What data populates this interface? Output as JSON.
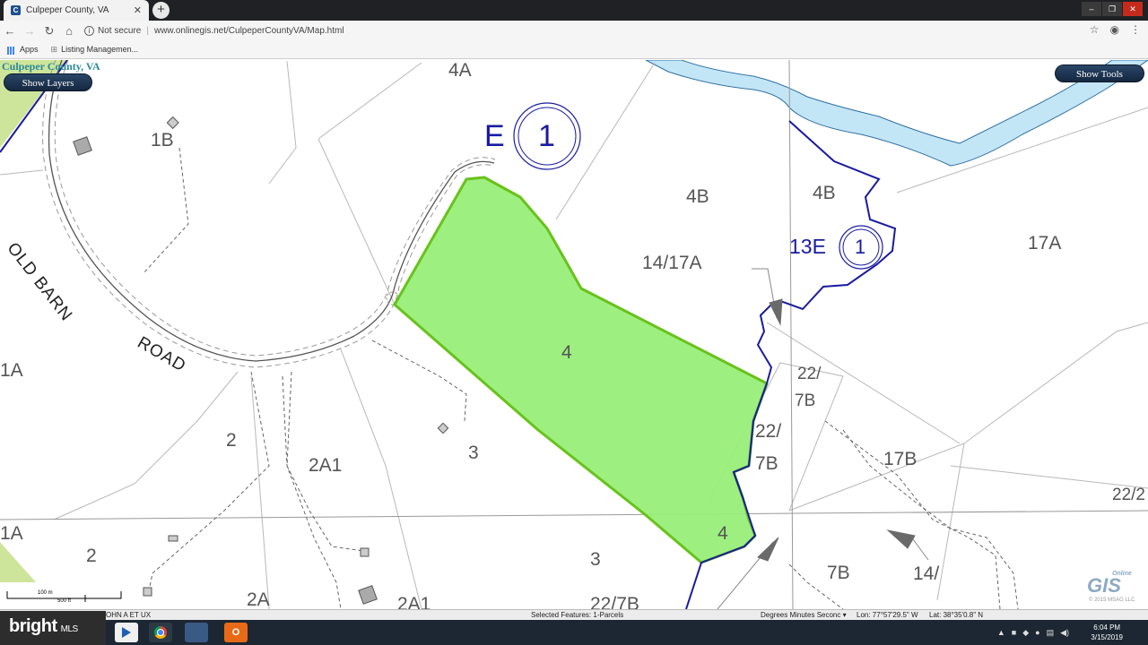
{
  "browser": {
    "tab_title": "Culpeper County, VA",
    "new_tab": "+",
    "security_label": "Not secure",
    "url": "www.onlinegis.net/CulpeperCountyVA/Map.html",
    "bookmarks": [
      "Apps",
      "Listing Managemen..."
    ]
  },
  "map": {
    "site_title": "Culpeper County, VA",
    "show_layers": "Show Layers",
    "show_tools": "Show Tools",
    "road_label_1": "OLD BARN",
    "road_label_2": "ROAD",
    "parcel_labels": [
      "4A",
      "1B",
      "4B",
      "4B",
      "14/17A",
      "17A",
      "1A",
      "2",
      "2A1",
      "3",
      "4",
      "22/",
      "7B",
      "22/",
      "7B",
      "17B",
      "22/2",
      "1A",
      "2",
      "3",
      "4",
      "7B",
      "14/",
      "2A",
      "2A1",
      "22/7B"
    ],
    "highlighted_parcel_labels": [
      "4",
      "4"
    ],
    "zone_labels": [
      {
        "letter": "E",
        "number": "1"
      },
      {
        "letter": "13E",
        "number": "1"
      }
    ],
    "scale_labels": [
      "100 m",
      "500 ft"
    ],
    "colors": {
      "selected_parcel": "#98ee78",
      "selected_outline": "#68c21b",
      "water": "#c3e6f7",
      "water_edge": "#2f6ea1",
      "zone": "#1a1aa0"
    }
  },
  "status_bar": {
    "owner": "OHN A ET UX",
    "selected": "Selected Features: 1-Parcels",
    "coord_mode": "Degrees Minutes Seconc ▾",
    "lon": "Lon: 77°57'29.5\" W",
    "lat": "Lat: 38°35'0.8\" N"
  },
  "branding": {
    "gis_logo": "GIS",
    "gis_online": "Online",
    "copyright": "© 2015 MSAG LLC"
  },
  "watermark": {
    "brand": "bright",
    "suffix": "MLS"
  },
  "taskbar": {
    "time": "6:04 PM",
    "date": "3/15/2019"
  }
}
